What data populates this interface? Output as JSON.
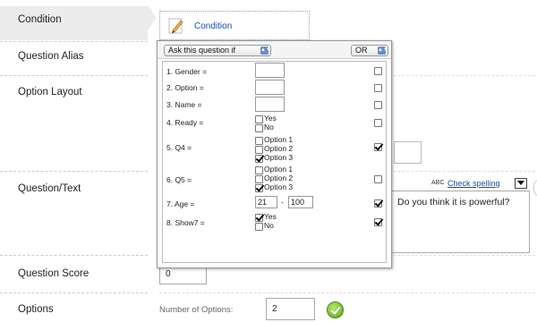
{
  "left_labels": [
    {
      "id": "condition",
      "label": "Condition"
    },
    {
      "id": "question-alias",
      "label": "Question Alias"
    },
    {
      "id": "option-layout",
      "label": "Option Layout"
    },
    {
      "id": "question-text",
      "label": "Question/Text"
    },
    {
      "id": "question-score",
      "label": "Question Score"
    },
    {
      "id": "options",
      "label": "Options"
    }
  ],
  "condition_button": {
    "label": "Condition",
    "icon": "pencil-icon"
  },
  "popup": {
    "mode_select": "Ask this question if",
    "logic_select": "OR",
    "rows": [
      {
        "label": "1. Gender =",
        "checked": false
      },
      {
        "label": "2. Option =",
        "checked": false
      },
      {
        "label": "3. Name =",
        "checked": false
      },
      {
        "label": "4. Ready =",
        "options": [
          "Yes",
          "No"
        ],
        "checked": false
      },
      {
        "label": "5. Q4 =",
        "options": [
          "Option 1",
          "Option 2",
          "Option 3"
        ],
        "selected": "Option 3",
        "checked": true
      },
      {
        "label": "6. Q5 =",
        "options": [
          "Option 1",
          "Option 2",
          "Option 3"
        ],
        "selected": "Option 3",
        "checked": false
      },
      {
        "label": "7. Age =",
        "range_from": "21",
        "range_sep": "-",
        "range_to": "100",
        "checked": true
      },
      {
        "label": "8. Show7 =",
        "options": [
          "Yes",
          "No"
        ],
        "selected": "Yes",
        "checked": true
      }
    ]
  },
  "spell": {
    "label": "Check spelling",
    "icon_text": "ABC"
  },
  "question_text": "Do you think it is powerful?",
  "question_score": "0",
  "options": {
    "number_label": "Number of Options:",
    "number_value": "2"
  }
}
